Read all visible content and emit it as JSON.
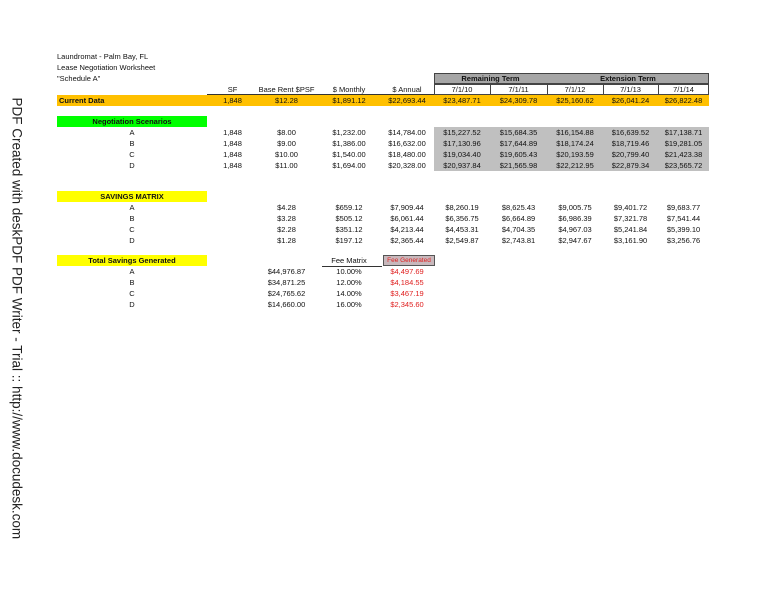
{
  "title_lines": [
    "Laundromat - Palm Bay, FL",
    "Lease Negotiation Worksheet",
    "\"Schedule A\""
  ],
  "watermark": "PDF Created with deskPDF PDF Writer - Trial :: http://www.docudesk.com",
  "group_headers": {
    "remaining": "Remaining Term",
    "extension": "Extension Term"
  },
  "columns": [
    "SF",
    "Base Rent $PSF",
    "$ Monthly",
    "$ Annual",
    "7/1/10",
    "7/1/11",
    "7/1/12",
    "7/1/13",
    "7/1/14"
  ],
  "current": {
    "label": "Current Data",
    "values": [
      "1,848",
      "$12.28",
      "$1,891.12",
      "$22,693.44",
      "$23,487.71",
      "$24,309.78",
      "$25,160.62",
      "$26,041.24",
      "$26,822.48"
    ]
  },
  "negotiation": {
    "label": "Negotiation Scenarios",
    "rows": [
      {
        "label": "A",
        "values": [
          "1,848",
          "$8.00",
          "$1,232.00",
          "$14,784.00",
          "$15,227.52",
          "$15,684.35",
          "$16,154.88",
          "$16,639.52",
          "$17,138.71"
        ]
      },
      {
        "label": "B",
        "values": [
          "1,848",
          "$9.00",
          "$1,386.00",
          "$16,632.00",
          "$17,130.96",
          "$17,644.89",
          "$18,174.24",
          "$18,719.46",
          "$19,281.05"
        ]
      },
      {
        "label": "C",
        "values": [
          "1,848",
          "$10.00",
          "$1,540.00",
          "$18,480.00",
          "$19,034.40",
          "$19,605.43",
          "$20,193.59",
          "$20,799.40",
          "$21,423.38"
        ]
      },
      {
        "label": "D",
        "values": [
          "1,848",
          "$11.00",
          "$1,694.00",
          "$20,328.00",
          "$20,937.84",
          "$21,565.98",
          "$22,212.95",
          "$22,879.34",
          "$23,565.72"
        ]
      }
    ]
  },
  "savings": {
    "label": "SAVINGS MATRIX",
    "rows": [
      {
        "label": "A",
        "values": [
          "",
          "$4.28",
          "$659.12",
          "$7,909.44",
          "$8,260.19",
          "$8,625.43",
          "$9,005.75",
          "$9,401.72",
          "$9,683.77"
        ]
      },
      {
        "label": "B",
        "values": [
          "",
          "$3.28",
          "$505.12",
          "$6,061.44",
          "$6,356.75",
          "$6,664.89",
          "$6,986.39",
          "$7,321.78",
          "$7,541.44"
        ]
      },
      {
        "label": "C",
        "values": [
          "",
          "$2.28",
          "$351.12",
          "$4,213.44",
          "$4,453.31",
          "$4,704.35",
          "$4,967.03",
          "$5,241.84",
          "$5,399.10"
        ]
      },
      {
        "label": "D",
        "values": [
          "",
          "$1.28",
          "$197.12",
          "$2,365.44",
          "$2,549.87",
          "$2,743.81",
          "$2,947.67",
          "$3,161.90",
          "$3,256.76"
        ]
      }
    ]
  },
  "totals": {
    "label": "Total Savings Generated",
    "fee_matrix_header": "Fee Matrix",
    "fee_generated_header": "Fee Generated",
    "rows": [
      {
        "label": "A",
        "values": [
          "",
          "$44,976.87",
          "10.00%",
          "$4,497.69"
        ]
      },
      {
        "label": "B",
        "values": [
          "",
          "$34,871.25",
          "12.00%",
          "$4,184.55"
        ]
      },
      {
        "label": "C",
        "values": [
          "",
          "$24,765.62",
          "14.00%",
          "$3,467.19"
        ]
      },
      {
        "label": "D",
        "values": [
          "",
          "$14,660.00",
          "16.00%",
          "$2,345.60"
        ]
      }
    ]
  },
  "colors": {
    "current": "#ffc000",
    "negotiation": "#00ff00",
    "savings": "#ffff00",
    "gray": "#c0c0c0",
    "fee": "#e02020"
  }
}
